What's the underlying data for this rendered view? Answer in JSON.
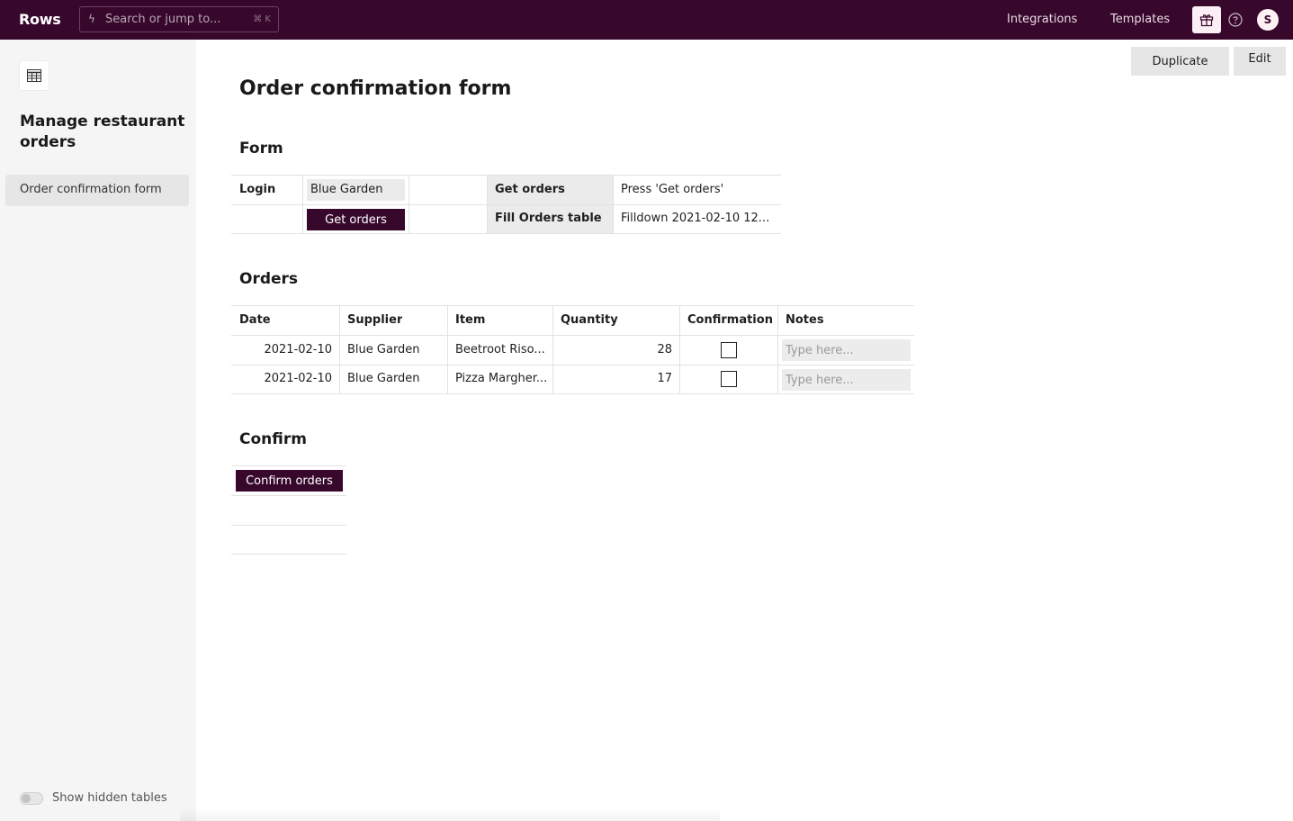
{
  "app": {
    "logo": "Rows",
    "search_placeholder": "Search or jump to...",
    "search_shortcut": "⌘ K",
    "nav": [
      "Integrations",
      "Templates"
    ],
    "avatar_initial": "S",
    "accent_color": "#37082c"
  },
  "sidebar": {
    "title": "Manage restaurant orders",
    "items": [
      {
        "label": "Order confirmation form",
        "selected": true
      }
    ],
    "show_hidden_label": "Show hidden tables",
    "show_hidden_on": false
  },
  "actions": {
    "duplicate": "Duplicate",
    "edit": "Edit"
  },
  "page": {
    "title": "Order confirmation form"
  },
  "form": {
    "title": "Form",
    "login_label": "Login",
    "login_value": "Blue Garden",
    "get_orders_button": "Get orders",
    "steps": [
      {
        "label": "Get orders",
        "value": "Press 'Get orders'"
      },
      {
        "label": "Fill Orders table",
        "value": "Filldown 2021-02-10 12..."
      }
    ]
  },
  "orders": {
    "title": "Orders",
    "columns": [
      "Date",
      "Supplier",
      "Item",
      "Quantity",
      "Confirmation",
      "Notes"
    ],
    "rows": [
      {
        "date": "2021-02-10",
        "supplier": "Blue Garden",
        "item": "Beetroot Riso...",
        "quantity": "28",
        "confirmed": false,
        "notes_placeholder": "Type here..."
      },
      {
        "date": "2021-02-10",
        "supplier": "Blue Garden",
        "item": "Pizza Margher...",
        "quantity": "17",
        "confirmed": false,
        "notes_placeholder": "Type here..."
      }
    ]
  },
  "confirm": {
    "title": "Confirm",
    "button": "Confirm orders"
  }
}
